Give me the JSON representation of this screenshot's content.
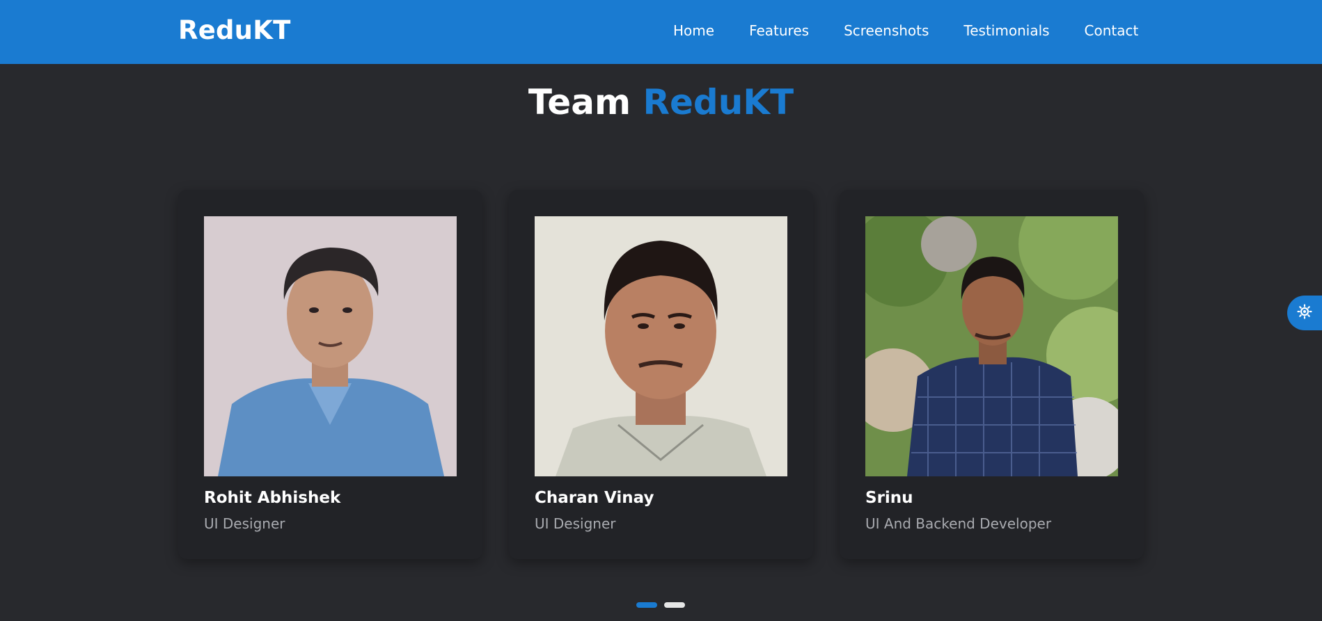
{
  "header": {
    "brand": "ReduKT",
    "nav": [
      "Home",
      "Features",
      "Screenshots",
      "Testimonials",
      "Contact"
    ]
  },
  "section": {
    "title_main": "Team",
    "title_accent": "ReduKT"
  },
  "team": [
    {
      "name": "Rohit Abhishek",
      "role": "UI Designer"
    },
    {
      "name": "Charan Vinay",
      "role": "UI Designer"
    },
    {
      "name": "Srinu",
      "role": "UI And Backend Developer"
    }
  ],
  "pagination": {
    "pages": 2,
    "active": 1
  },
  "theme_toggle": {
    "icon": "sun-icon"
  },
  "colors": {
    "primary": "#1a7bd1",
    "background": "#28292d",
    "card": "#222327",
    "muted_text": "#a9abb0"
  }
}
